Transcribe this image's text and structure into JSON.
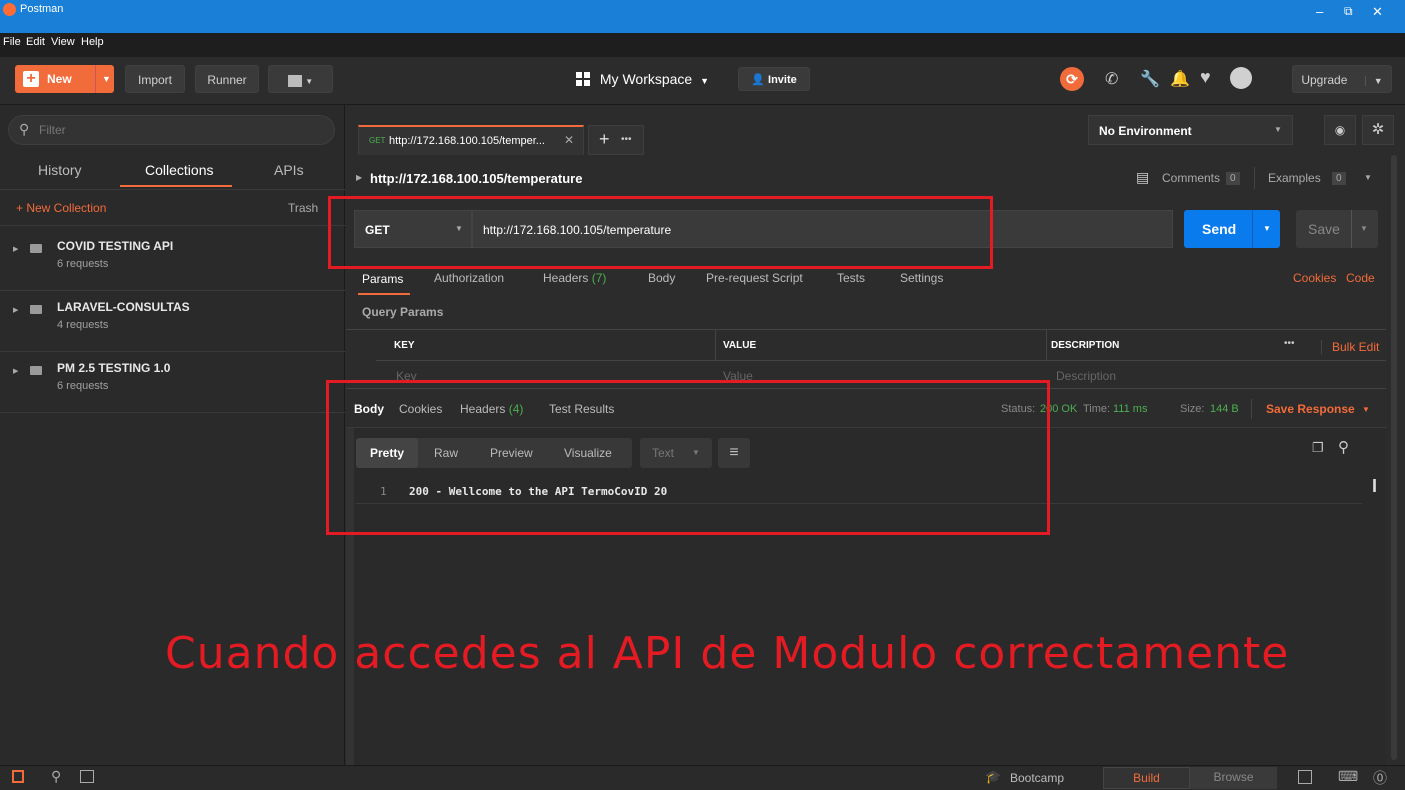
{
  "window": {
    "title": "Postman",
    "minimize": "–",
    "restore": "⧉",
    "close": "✕"
  },
  "menu": [
    "File",
    "Edit",
    "View",
    "Help"
  ],
  "toolbar": {
    "new_label": "New",
    "import_label": "Import",
    "runner_label": "Runner",
    "workspace_label": "My Workspace",
    "invite_label": "Invite",
    "upgrade_label": "Upgrade"
  },
  "sidebar": {
    "filter_placeholder": "Filter",
    "tabs": [
      "History",
      "Collections",
      "APIs"
    ],
    "active_tab": "Collections",
    "new_collection_label": "+ New Collection",
    "trash_label": "Trash",
    "collections": [
      {
        "name": "COVID TESTING API",
        "count": "6 requests"
      },
      {
        "name": "LARAVEL-CONSULTAS",
        "count": "4 requests"
      },
      {
        "name": "PM 2.5 TESTING 1.0",
        "count": "6 requests"
      }
    ]
  },
  "request_tab": {
    "method": "GET",
    "title": "http://172.168.100.105/temper...",
    "close": "✕",
    "add": "+",
    "more": "•••"
  },
  "environment": {
    "label": "No Environment"
  },
  "request": {
    "breadcrumb": "http://172.168.100.105/temperature",
    "comments_label": "Comments",
    "comments_count": "0",
    "examples_label": "Examples",
    "examples_count": "0",
    "method": "GET",
    "url": "http://172.168.100.105/temperature",
    "send_label": "Send",
    "save_label": "Save"
  },
  "request_tabs": {
    "items": [
      "Params",
      "Authorization",
      "Headers",
      "Body",
      "Pre-request Script",
      "Tests",
      "Settings"
    ],
    "headers_count": "(7)",
    "cookies_label": "Cookies",
    "code_label": "Code"
  },
  "params": {
    "section_label": "Query Params",
    "columns": [
      "KEY",
      "VALUE",
      "DESCRIPTION"
    ],
    "more": "•••",
    "bulk_edit": "Bulk Edit",
    "key_placeholder": "Key",
    "value_placeholder": "Value",
    "description_placeholder": "Description"
  },
  "response": {
    "tabs": [
      "Body",
      "Cookies",
      "Headers",
      "Test Results"
    ],
    "headers_count": "(4)",
    "status_label": "Status:",
    "status_value": "200 OK",
    "time_label": "Time:",
    "time_value": "111 ms",
    "size_label": "Size:",
    "size_value": "144 B",
    "save_response": "Save Response",
    "view_tabs": [
      "Pretty",
      "Raw",
      "Preview",
      "Visualize"
    ],
    "format": "Text",
    "line_number": "1",
    "line_text": "200 - Wellcome to the API TermoCovID 20"
  },
  "annotation": "Cuando accedes al API de Modulo correctamente",
  "statusbar": {
    "bootcamp_label": "Bootcamp",
    "build_label": "Build",
    "browse_label": "Browse"
  },
  "colors": {
    "accent": "#f26b3a",
    "send_blue": "#097bed",
    "title_blue": "#1a7fd6",
    "annotation_red": "#e41b23",
    "green": "#4caf50"
  }
}
